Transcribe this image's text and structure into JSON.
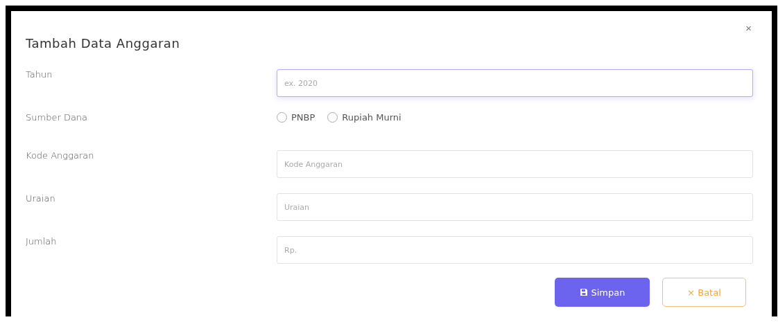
{
  "dialog": {
    "title": "Tambah Data Anggaran",
    "close": "×"
  },
  "fields": [
    {
      "kind": "text",
      "label": "Tahun",
      "placeholder": "ex. 2020",
      "focused": true
    },
    {
      "kind": "radio",
      "label": "Sumber Dana",
      "options": [
        {
          "label": "PNBP",
          "selected": false
        },
        {
          "label": "Rupiah Murni",
          "selected": false
        }
      ]
    },
    {
      "kind": "text",
      "label": "Kode Anggaran",
      "placeholder": "Kode Anggaran",
      "focused": false
    },
    {
      "kind": "text",
      "label": "Uraian",
      "placeholder": "Uraian",
      "focused": false
    },
    {
      "kind": "text",
      "label": "Jumlah",
      "placeholder": "Rp.",
      "focused": false
    }
  ],
  "buttons": [
    {
      "kind": "primary",
      "label": "Simpan"
    },
    {
      "kind": "outline",
      "label": "× Batal"
    }
  ]
}
